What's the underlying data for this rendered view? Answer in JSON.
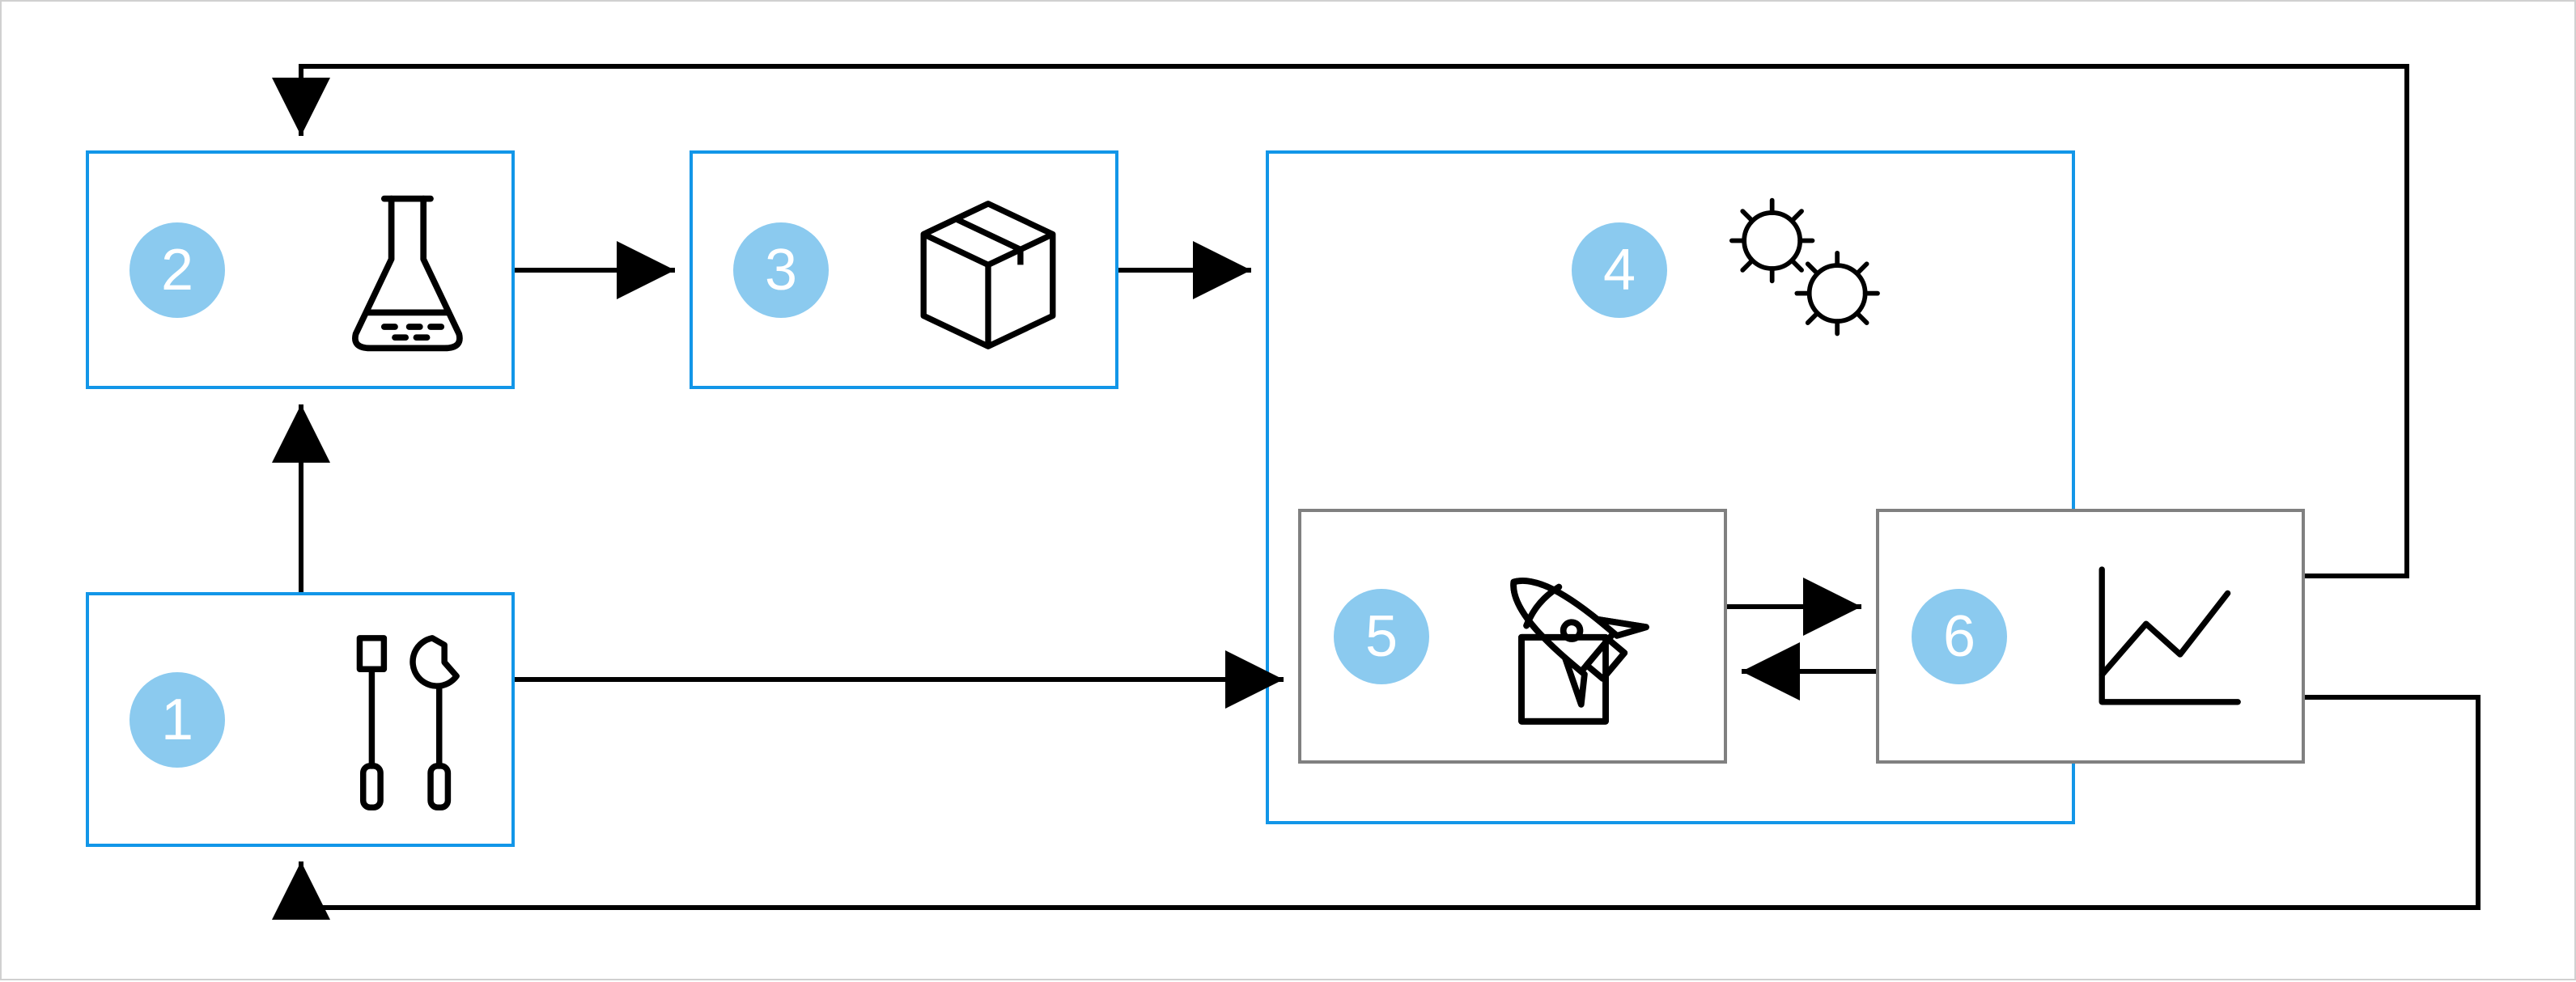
{
  "diagram": {
    "badge_color": "#8bcaef",
    "border_blue": "#1296e8",
    "border_grey": "#808080",
    "nodes": {
      "n1": {
        "label": "1",
        "icon": "tools-icon"
      },
      "n2": {
        "label": "2",
        "icon": "flask-icon"
      },
      "n3": {
        "label": "3",
        "icon": "package-icon"
      },
      "n4": {
        "label": "4",
        "icon": "gears-icon"
      },
      "n5": {
        "label": "5",
        "icon": "rocket-icon"
      },
      "n6": {
        "label": "6",
        "icon": "chart-icon"
      }
    },
    "edges": [
      {
        "from": "n1",
        "to": "n2"
      },
      {
        "from": "n2",
        "to": "n3"
      },
      {
        "from": "n3",
        "to": "n4"
      },
      {
        "from": "n1",
        "to": "n5"
      },
      {
        "from": "n5",
        "to": "n6"
      },
      {
        "from": "n6",
        "to": "n5"
      },
      {
        "from": "n4",
        "to": "n2"
      },
      {
        "from": "n6",
        "to": "n1"
      }
    ]
  }
}
